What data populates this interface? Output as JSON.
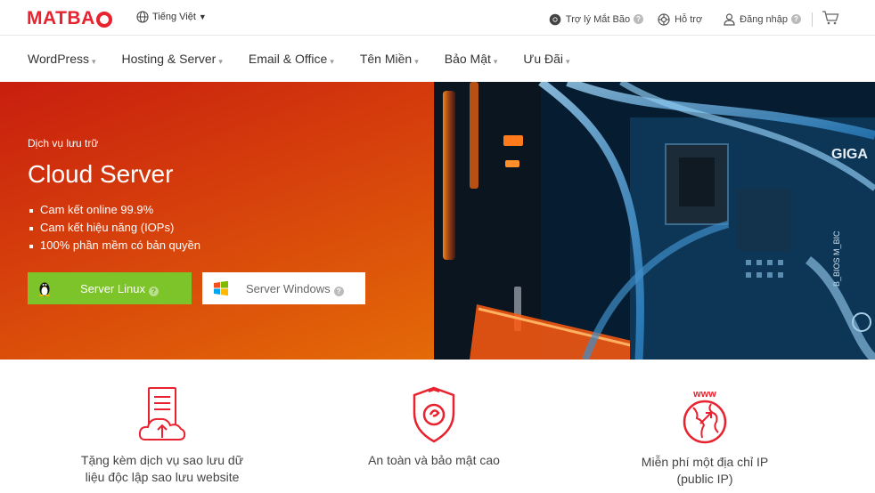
{
  "brand": {
    "name": "MATBAO",
    "logo_text": "MATBA",
    "color": "#e8222e"
  },
  "topbar": {
    "language": "Tiếng Việt",
    "assistant": "Trợ lý Mắt Bão",
    "support": "Hỗ trợ",
    "login": "Đăng nhập",
    "icons": [
      "globe-icon",
      "chrome-icon",
      "support-icon",
      "user-icon",
      "cart-icon"
    ]
  },
  "nav": {
    "items": [
      "WordPress",
      "Hosting & Server",
      "Email & Office",
      "Tên Miền",
      "Bảo Mật",
      "Ưu Đãi"
    ]
  },
  "hero": {
    "subtitle": "Dịch vụ lưu trữ",
    "title": "Cloud Server",
    "bullets": [
      "Cam kết online 99.9%",
      "Cam kết hiệu năng (IOPs)",
      "100% phần mềm có bản quyền"
    ],
    "buttons": {
      "linux": "Server Linux",
      "windows": "Server Windows"
    },
    "image_text": "GIGA",
    "image_text_2": "B_BIOS M_BIC",
    "colors": {
      "gradient_start": "#c81e0e",
      "gradient_end": "#e46a07",
      "linux_button": "#7cc42a"
    }
  },
  "features": [
    {
      "label_1": "Tặng kèm dịch vụ sao lưu dữ",
      "label_2": "liệu độc lập sao lưu website",
      "icon": "backup-server-icon"
    },
    {
      "label_1": "An toàn và bảo mật cao",
      "label_2": "",
      "icon": "security-shield-icon"
    },
    {
      "label_1": "Miễn phí một địa chỉ IP",
      "label_2": "(public IP)",
      "icon": "www-ip-icon"
    }
  ]
}
